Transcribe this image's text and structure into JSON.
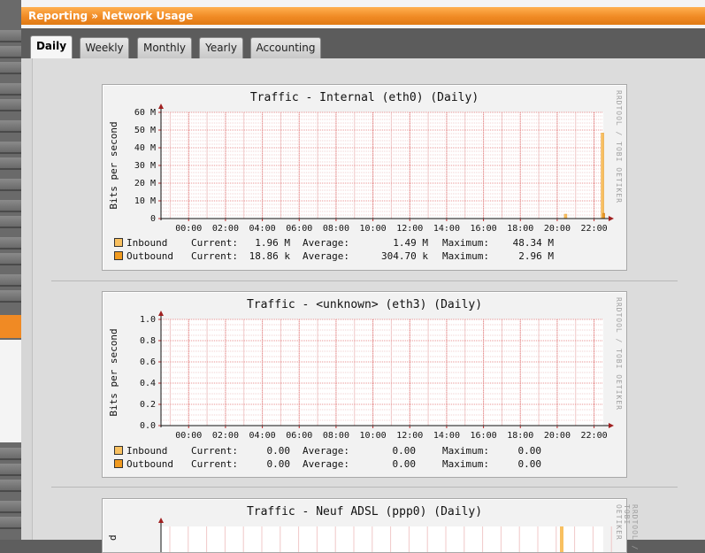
{
  "breadcrumb": "Reporting » Network Usage",
  "tabs": [
    {
      "label": "Daily",
      "active": true
    },
    {
      "label": "Weekly",
      "active": false
    },
    {
      "label": "Monthly",
      "active": false
    },
    {
      "label": "Yearly",
      "active": false
    },
    {
      "label": "Accounting",
      "active": false
    }
  ],
  "watermark": "RRDTOOL / TOBI OETIKER",
  "colors": {
    "inbound": "#f8c060",
    "outbound": "#f09a20",
    "accent": "#f08a24"
  },
  "x_ticks": [
    "00:00",
    "02:00",
    "04:00",
    "06:00",
    "08:00",
    "10:00",
    "12:00",
    "14:00",
    "16:00",
    "18:00",
    "20:00",
    "22:00"
  ],
  "legend_fields": {
    "current": "Current:",
    "average": "Average:",
    "maximum": "Maximum:"
  },
  "graphs": [
    {
      "title": "Traffic - Internal (eth0) (Daily)",
      "ylabel": "Bits per second",
      "y_ticks": [
        "0",
        "10 M",
        "20 M",
        "30 M",
        "40 M",
        "50 M",
        "60 M"
      ],
      "inbound": {
        "label": "Inbound",
        "current": "1.96 M",
        "average": "1.49 M",
        "maximum": "48.34 M"
      },
      "outbound": {
        "label": "Outbound",
        "current": "18.86 k",
        "average": "304.70 k",
        "maximum": "2.96 M"
      }
    },
    {
      "title": "Traffic - <unknown> (eth3) (Daily)",
      "ylabel": "Bits per second",
      "y_ticks": [
        "0.0",
        "0.2",
        "0.4",
        "0.6",
        "0.8",
        "1.0"
      ],
      "inbound": {
        "label": "Inbound",
        "current": "0.00",
        "average": "0.00",
        "maximum": "0.00"
      },
      "outbound": {
        "label": "Outbound",
        "current": "0.00",
        "average": "0.00",
        "maximum": "0.00"
      }
    },
    {
      "title": "Traffic - Neuf ADSL (ppp0) (Daily)",
      "ylabel": "d"
    }
  ],
  "chart_data": [
    {
      "type": "area",
      "title": "Traffic - Internal (eth0) (Daily)",
      "ylabel": "Bits per second",
      "x": [
        "00:00",
        "02:00",
        "04:00",
        "06:00",
        "08:00",
        "10:00",
        "12:00",
        "14:00",
        "16:00",
        "18:00",
        "20:00",
        "22:00"
      ],
      "ylim": [
        0,
        60000000
      ],
      "grid": true,
      "series": [
        {
          "name": "Inbound",
          "values": [
            0,
            0,
            0,
            0,
            0,
            0,
            0,
            0,
            0,
            0,
            2500000,
            48340000
          ]
        },
        {
          "name": "Outbound",
          "values": [
            0,
            0,
            0,
            0,
            0,
            0,
            0,
            0,
            0,
            0,
            0,
            2960000
          ]
        }
      ]
    },
    {
      "type": "area",
      "title": "Traffic - <unknown> (eth3) (Daily)",
      "ylabel": "Bits per second",
      "x": [
        "00:00",
        "02:00",
        "04:00",
        "06:00",
        "08:00",
        "10:00",
        "12:00",
        "14:00",
        "16:00",
        "18:00",
        "20:00",
        "22:00"
      ],
      "ylim": [
        0,
        1.0
      ],
      "grid": true,
      "series": [
        {
          "name": "Inbound",
          "values": [
            0,
            0,
            0,
            0,
            0,
            0,
            0,
            0,
            0,
            0,
            0,
            0
          ]
        },
        {
          "name": "Outbound",
          "values": [
            0,
            0,
            0,
            0,
            0,
            0,
            0,
            0,
            0,
            0,
            0,
            0
          ]
        }
      ]
    }
  ]
}
